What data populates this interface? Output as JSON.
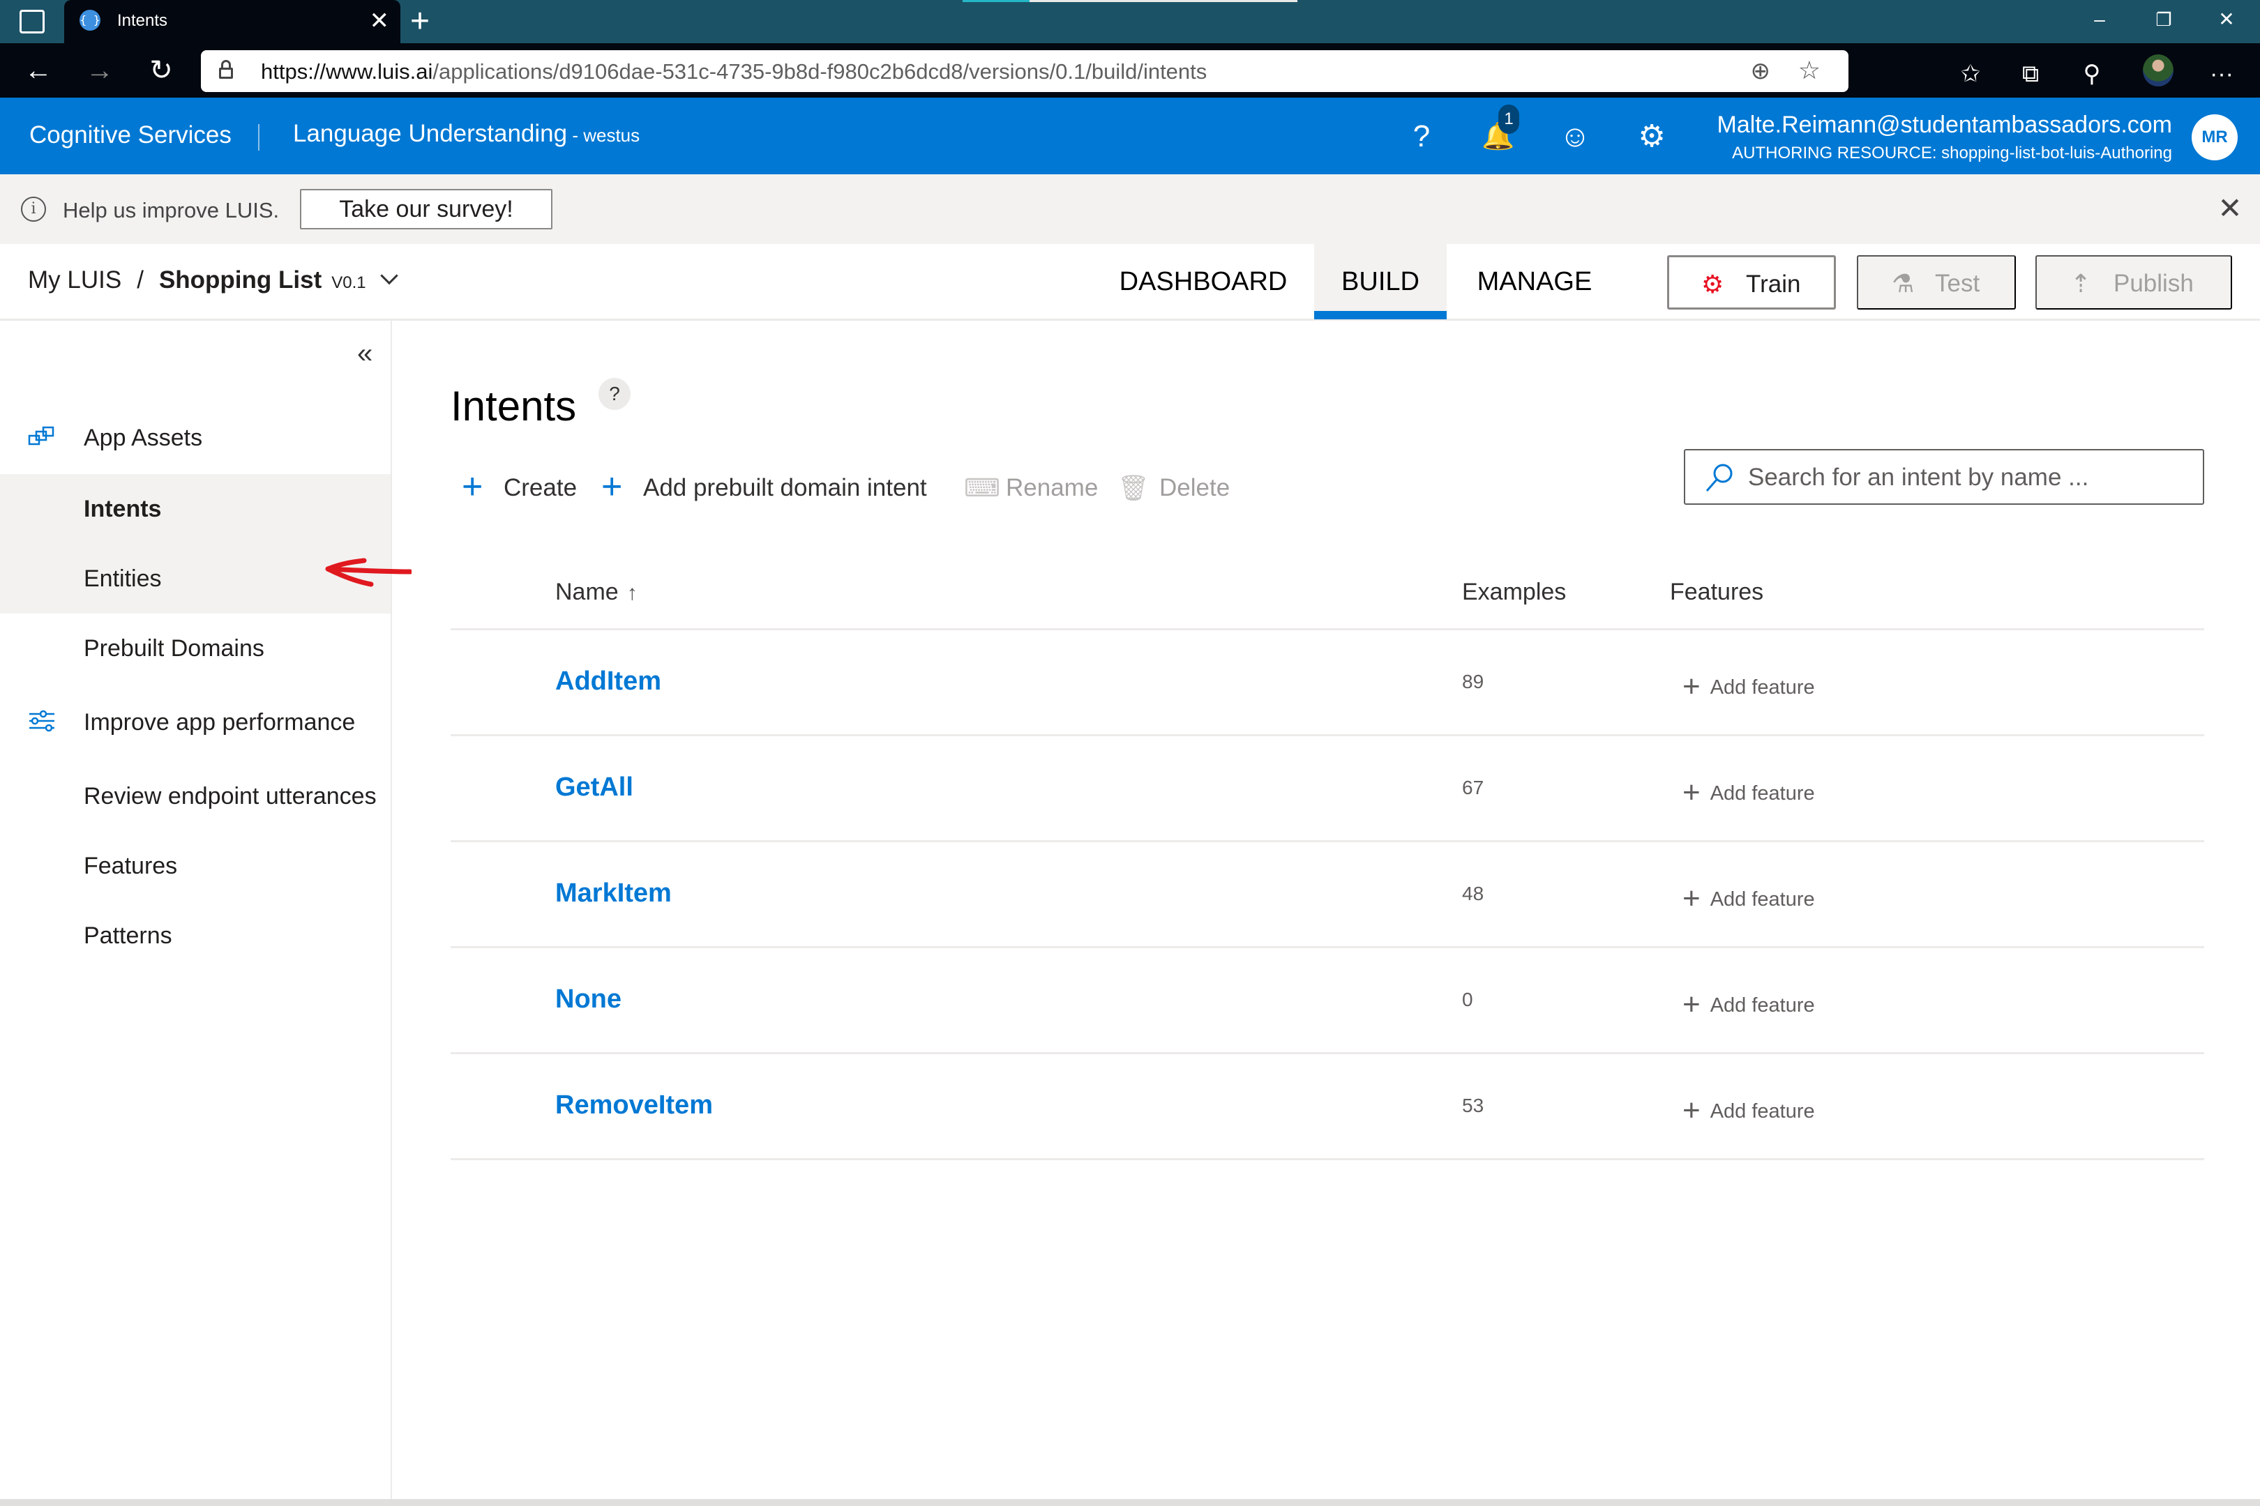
{
  "browser": {
    "tab_title": "Intents",
    "tab_favicon": "{ }",
    "url_prefix": "https://www.luis.ai",
    "url_rest": "/applications/d9106dae-531c-4735-9b8d-f980c2b6dcd8/versions/0.1/build/intents",
    "icons": {
      "back": "←",
      "forward": "→",
      "refresh": "↻",
      "zoom": "⊕",
      "favorite": "☆",
      "favorites_bar": "✩",
      "collections": "⧉",
      "extensions": "⚲",
      "more": "···",
      "close_tab": "✕",
      "new_tab": "+",
      "minimize": "–",
      "restore": "❐",
      "close_window": "✕"
    }
  },
  "header": {
    "brand": "Cognitive Services",
    "product": "Language Understanding",
    "region": " - westus",
    "help_icon": "?",
    "notification_count": "1",
    "notification_icon": "🔔",
    "feedback_icon": "☺",
    "settings_icon": "⚙",
    "user_email": "Malte.Reimann@studentambassadors.com",
    "authoring_resource": "AUTHORING RESOURCE:  shopping-list-bot-luis-Authoring",
    "avatar_initials": "MR"
  },
  "banner": {
    "info_icon": "i",
    "message": "Help us improve LUIS.",
    "survey_button": "Take our survey!",
    "close_icon": "✕"
  },
  "appnav": {
    "breadcrumb_root": "My LUIS",
    "separator": "/",
    "app_name": "Shopping List",
    "version": "V0.1",
    "tabs": [
      {
        "label": "DASHBOARD",
        "active": false
      },
      {
        "label": "BUILD",
        "active": true
      },
      {
        "label": "MANAGE",
        "active": false
      }
    ],
    "train": {
      "label": "Train",
      "icon": "⚙"
    },
    "test": {
      "label": "Test",
      "icon": "⚗"
    },
    "publish": {
      "label": "Publish",
      "icon": "⇡"
    }
  },
  "sidebar": {
    "collapse_icon": "«",
    "items": [
      {
        "label": "App Assets",
        "icon": "app-assets-icon",
        "state": "normal"
      },
      {
        "label": "Intents",
        "state": "selected"
      },
      {
        "label": "Entities",
        "state": "hover"
      },
      {
        "label": "Prebuilt Domains",
        "state": "normal"
      },
      {
        "label": "Improve app performance",
        "icon": "sliders-icon",
        "state": "normal"
      },
      {
        "label": "Review endpoint utterances",
        "state": "normal"
      },
      {
        "label": "Features",
        "state": "normal"
      },
      {
        "label": "Patterns",
        "state": "normal"
      }
    ]
  },
  "main": {
    "title": "Intents",
    "help": "?",
    "commands": [
      {
        "label": "Create",
        "icon": "+",
        "enabled": true
      },
      {
        "label": "Add prebuilt domain intent",
        "icon": "+",
        "enabled": true
      },
      {
        "label": "Rename",
        "icon": "⌨",
        "enabled": false
      },
      {
        "label": "Delete",
        "icon": "🗑",
        "enabled": false
      }
    ],
    "search_placeholder": "Search for an intent by name ...",
    "table": {
      "columns": [
        "Name",
        "Examples",
        "Features"
      ],
      "sort_indicator": "↑",
      "rows": [
        {
          "name": "AddItem",
          "examples": "89",
          "feature_action": "Add feature"
        },
        {
          "name": "GetAll",
          "examples": "67",
          "feature_action": "Add feature"
        },
        {
          "name": "MarkItem",
          "examples": "48",
          "feature_action": "Add feature"
        },
        {
          "name": "None",
          "examples": "0",
          "feature_action": "Add feature"
        },
        {
          "name": "RemoveItem",
          "examples": "53",
          "feature_action": "Add feature"
        }
      ],
      "plus_icon": "+"
    }
  },
  "colors": {
    "brand_blue": "#0078d4",
    "tabstrip": "#1c5266",
    "train_red": "#e81123",
    "annotation_arrow": "#e0191f"
  }
}
